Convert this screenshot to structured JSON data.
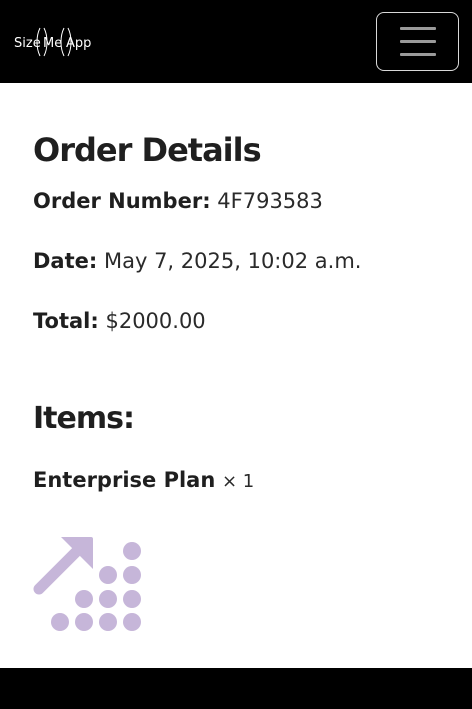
{
  "navbar": {
    "brand_logo_text": "SizeMeApp",
    "toggler_icon": "hamburger-menu-icon"
  },
  "order": {
    "title": "Order Details",
    "number_label": "Order Number:",
    "number_value": "4F793583",
    "date_label": "Date:",
    "date_value": "May 7, 2025, 10:02 a.m.",
    "total_label": "Total:",
    "total_value": "$2000.00"
  },
  "items": {
    "heading": "Items:",
    "list": [
      {
        "name": "Enterprise Plan",
        "qty": "× 1",
        "icon": "growth-arrow-dots-icon"
      }
    ]
  },
  "colors": {
    "navbar_bg": "#000000",
    "icon_purple": "#c6b6d9",
    "text": "#1f1f1f"
  }
}
